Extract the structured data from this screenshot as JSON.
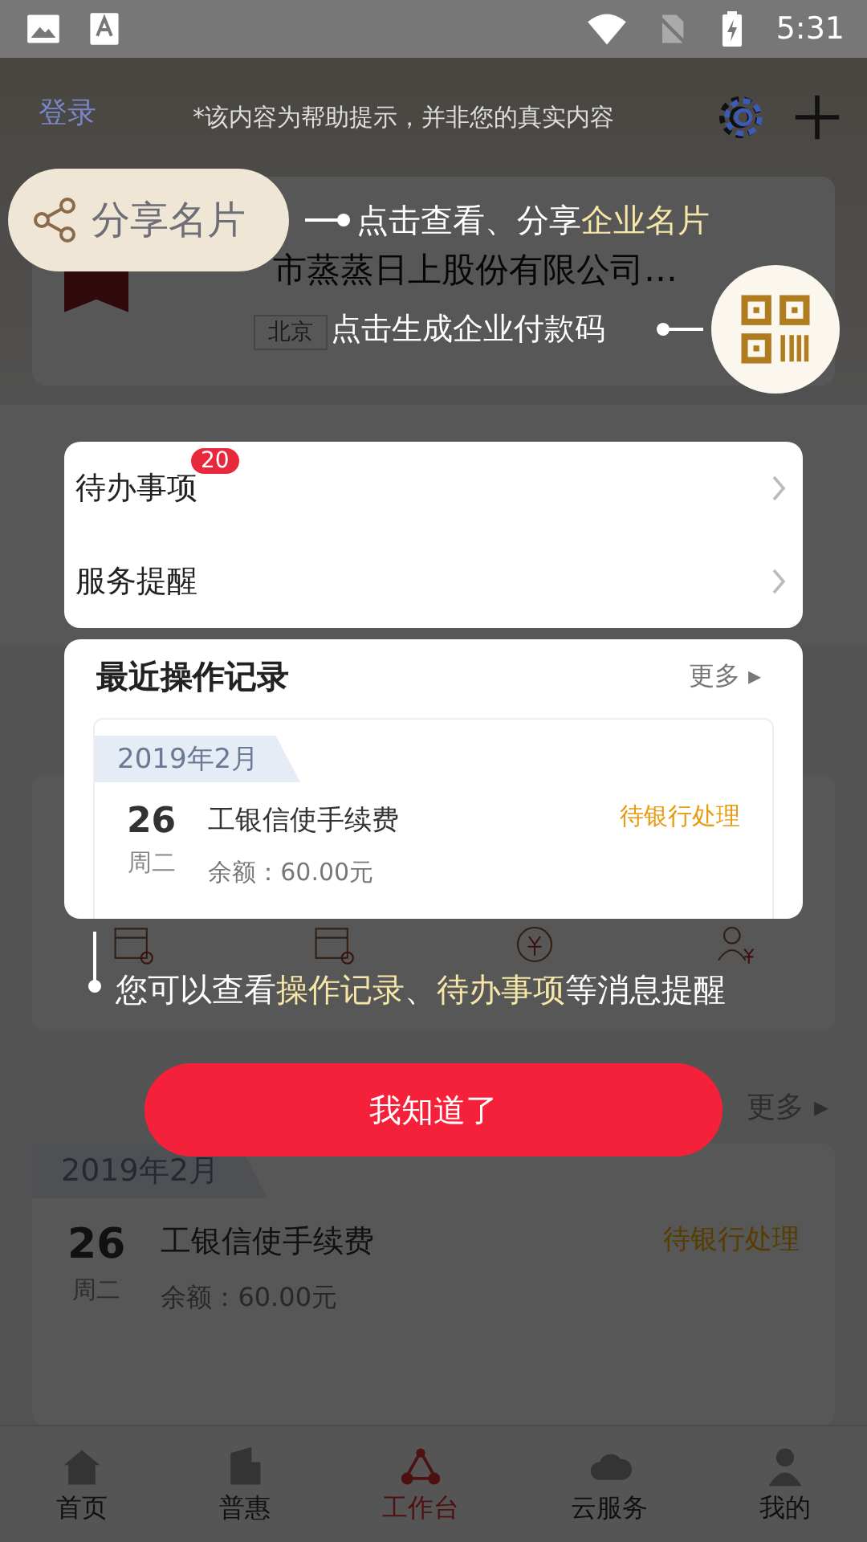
{
  "status_bar": {
    "time": "5:31"
  },
  "background": {
    "company": {
      "name": "市蒸蒸日上股份有限公司…",
      "tags": [
        "北京"
      ]
    },
    "recent": {
      "more": "更多 ▸",
      "record": {
        "month": "2019年2月",
        "day": "26",
        "weekday": "周二",
        "title": "工银信使手续费",
        "balance": "余额：60.00元",
        "status": "待银行处理"
      }
    },
    "nav": [
      {
        "label": "首页",
        "selected": false
      },
      {
        "label": "普惠",
        "selected": false
      },
      {
        "label": "工作台",
        "selected": true
      },
      {
        "label": "云服务",
        "selected": false
      },
      {
        "label": "我的",
        "selected": false
      }
    ]
  },
  "guide": {
    "login": "登录",
    "notice": "*该内容为帮助提示，并非您的真实内容",
    "share_button": "分享名片",
    "share_tip": [
      {
        "text": "点击查看、分享",
        "highlight": false
      },
      {
        "text": "企业名片",
        "highlight": true
      }
    ],
    "qr_tip": "点击生成企业付款码",
    "todo_card": {
      "rows": [
        {
          "label": "待办事项",
          "badge": "20"
        },
        {
          "label": "服务提醒"
        }
      ]
    },
    "recent_card": {
      "title": "最近操作记录",
      "more": "更多 ▸",
      "record": {
        "month": "2019年2月",
        "day": "26",
        "weekday": "周二",
        "title": "工银信使手续费",
        "balance": "余额：60.00元",
        "status": "待银行处理"
      }
    },
    "message_tip": [
      {
        "text": "您可以查看",
        "highlight": false
      },
      {
        "text": "操作记录",
        "highlight": true
      },
      {
        "text": "、",
        "highlight": false
      },
      {
        "text": "待办事项",
        "highlight": true
      },
      {
        "text": "等消息提醒",
        "highlight": false
      }
    ],
    "confirm_button": "我知道了"
  }
}
